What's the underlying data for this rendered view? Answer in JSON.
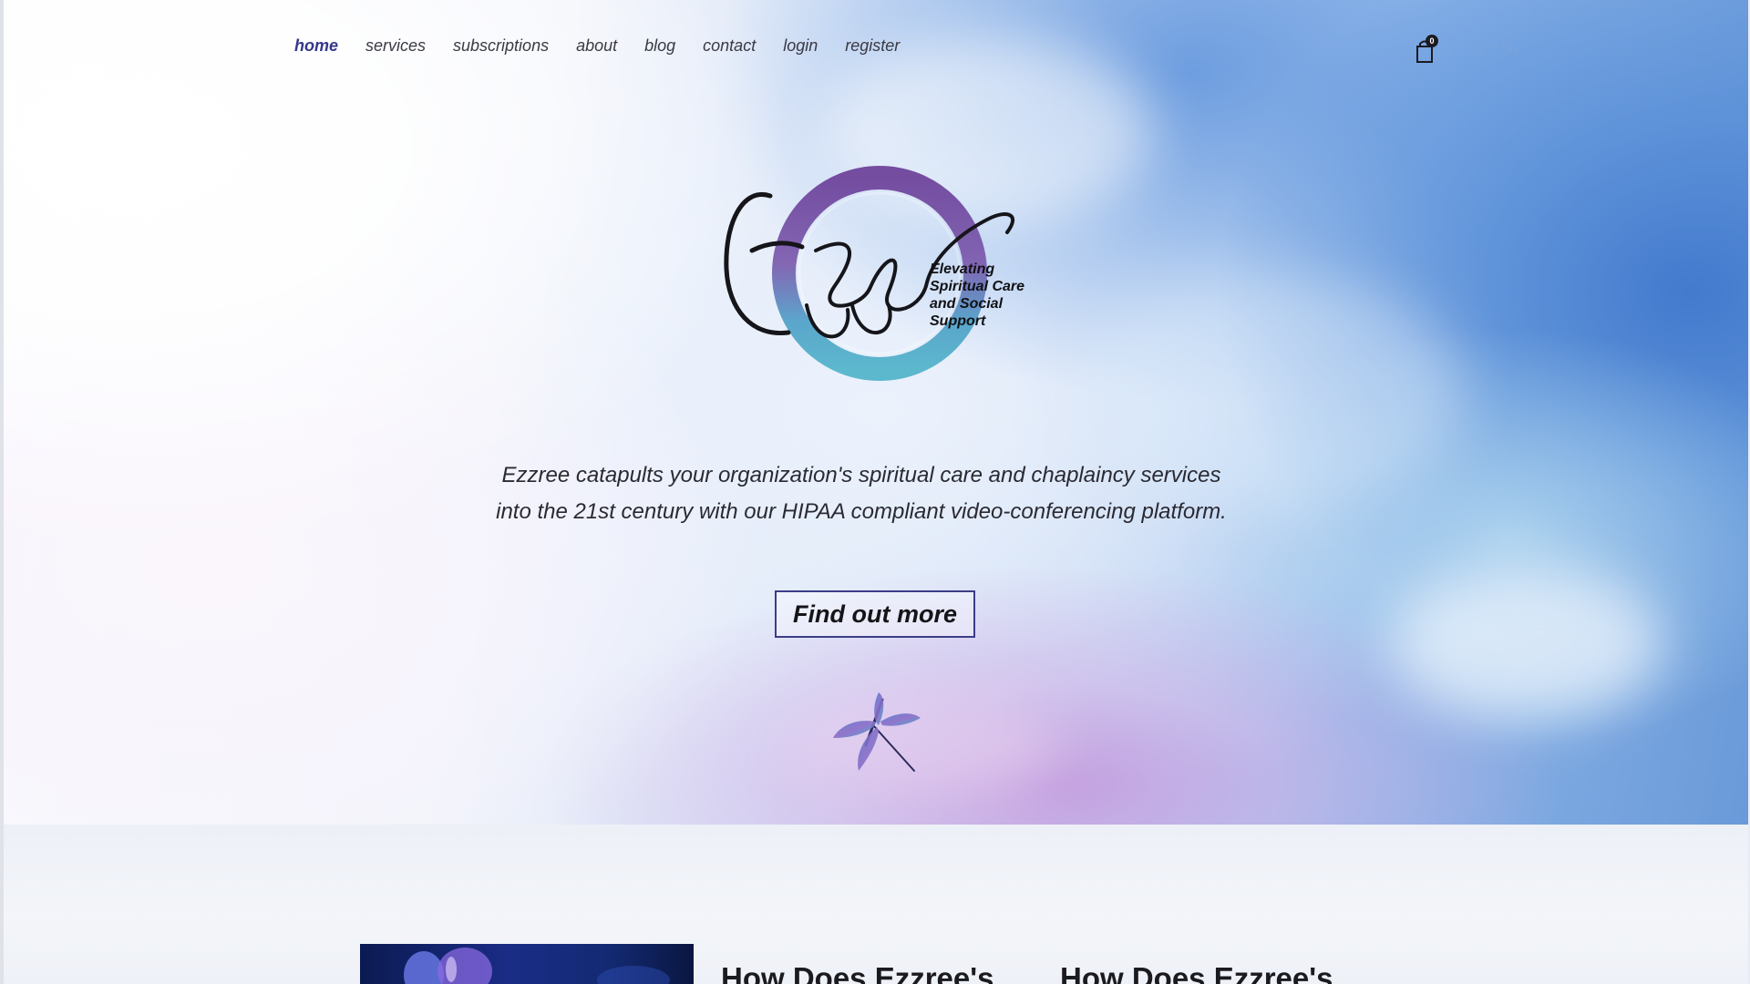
{
  "nav": {
    "items": [
      {
        "label": "home",
        "active": true
      },
      {
        "label": "services",
        "active": false
      },
      {
        "label": "subscriptions",
        "active": false
      },
      {
        "label": "about",
        "active": false
      },
      {
        "label": "blog",
        "active": false
      },
      {
        "label": "contact",
        "active": false
      },
      {
        "label": "login",
        "active": false
      },
      {
        "label": "register",
        "active": false
      }
    ],
    "cart_count": "0"
  },
  "logo": {
    "wordmark": "Ezzree",
    "tagline_lines": [
      "Elevating",
      "Spiritual Care",
      "and Social",
      "Support"
    ]
  },
  "hero": {
    "description": "Ezzree catapults your organization's spiritual care and chaplaincy services into the 21st century with our HIPAA compliant video-conferencing platform.",
    "cta_label": "Find out more"
  },
  "features": {
    "headings": [
      "How Does Ezzree's",
      "How Does Ezzree's"
    ]
  },
  "colors": {
    "nav_active": "#34378a",
    "cta_border": "#3b3d86",
    "logo_ring_purple": "#6b3f98",
    "logo_ring_teal": "#4fb3c9"
  },
  "icons": {
    "cart": "shopping-bag-icon",
    "dragonfly": "dragonfly-icon"
  }
}
